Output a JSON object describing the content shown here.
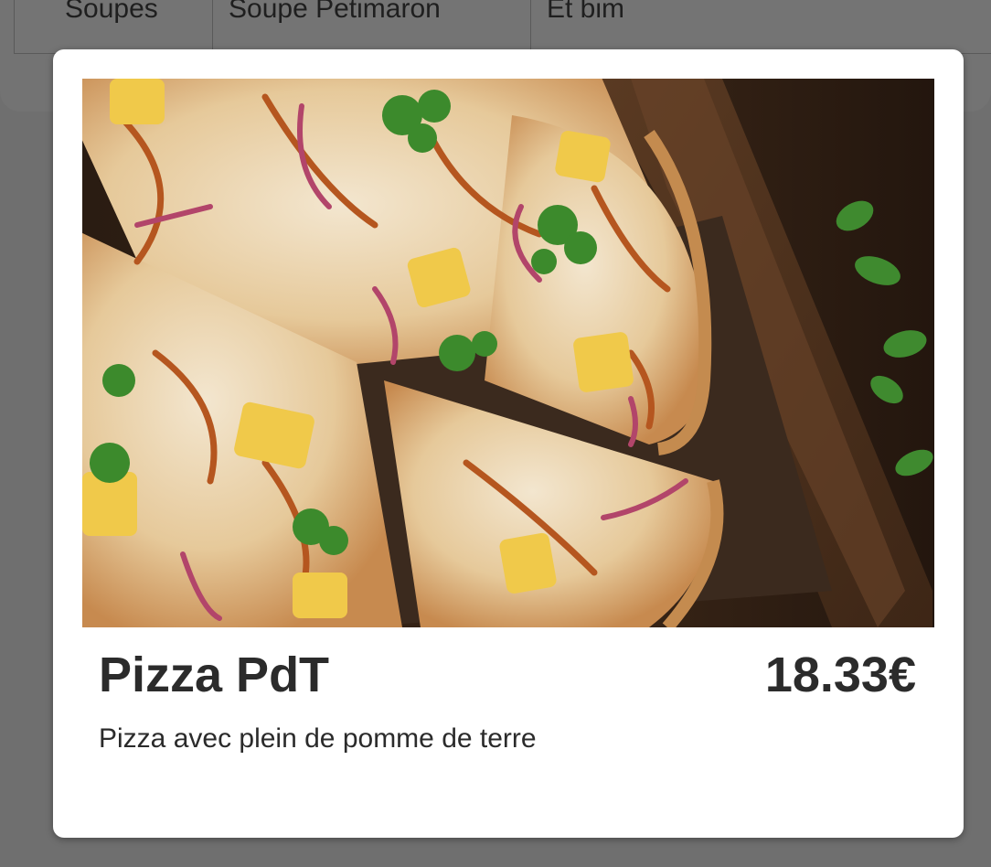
{
  "background_table": {
    "cells": [
      "Soupes",
      "Soupe Petimaron",
      "Et bim"
    ]
  },
  "modal": {
    "image_alt": "pizza-photo",
    "title": "Pizza PdT",
    "price": "18.33€",
    "description": "Pizza avec plein de pomme de terre"
  },
  "colors": {
    "overlay": "#6f6f6f",
    "modal_background": "#ffffff",
    "text": "#2b2b2b"
  }
}
